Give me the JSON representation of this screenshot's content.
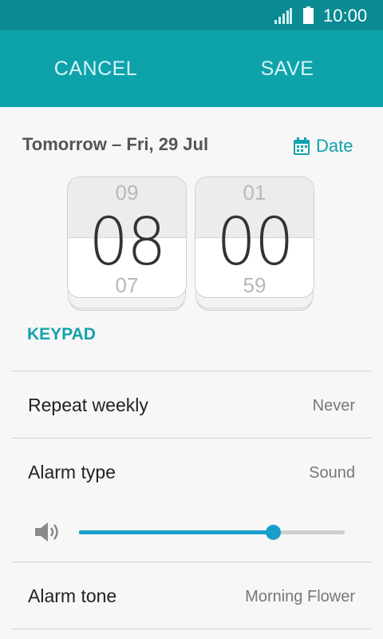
{
  "status_bar": {
    "time": "10:00",
    "signal_icon": "signal-icon",
    "battery_icon": "battery-icon"
  },
  "action_bar": {
    "cancel_label": "CANCEL",
    "save_label": "SAVE"
  },
  "date": {
    "text": "Tomorrow – Fri, 29 Jul",
    "link_label": "Date",
    "link_icon": "calendar-icon"
  },
  "time_picker": {
    "hour": {
      "prev": "09",
      "current": "08",
      "next": "07"
    },
    "minute": {
      "prev": "01",
      "current": "00",
      "next": "59"
    }
  },
  "keypad_label": "KEYPAD",
  "repeat": {
    "label": "Repeat weekly",
    "value": "Never"
  },
  "alarm_type": {
    "label": "Alarm type",
    "value": "Sound"
  },
  "volume": {
    "icon": "speaker-icon",
    "level": 0.73
  },
  "alarm_tone": {
    "label": "Alarm tone",
    "value": "Morning Flower"
  },
  "colors": {
    "accent": "#14a2ad",
    "action_bar": "#0ea3ab",
    "status_bar": "#0a8a92",
    "slider": "#1a9fcb"
  }
}
